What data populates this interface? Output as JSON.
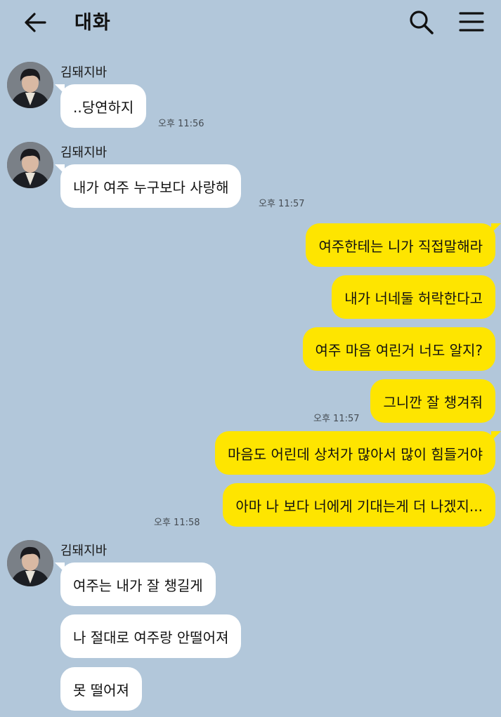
{
  "header": {
    "title": "대화"
  },
  "messages": [
    {
      "sender": "김돼지바",
      "text": "..당연하지",
      "time": "오후 11:56"
    },
    {
      "sender": "김돼지바",
      "text": "내가 여주 누구보다 사랑해",
      "time": "오후 11:57"
    },
    {
      "text": "여주한테는 니가 직접말해라"
    },
    {
      "text": "내가 너네둘 허락한다고"
    },
    {
      "text": "여주 마음 여린거 너도 알지?"
    },
    {
      "text": "그니깐 잘 챙겨줘",
      "time": "오후 11:57"
    },
    {
      "text": "마음도 어린데 상처가 많아서 많이 힘들거야"
    },
    {
      "text": "아마 나 보다 너에게 기대는게 더 나겠지...",
      "time": "오후 11:58"
    },
    {
      "sender": "김돼지바",
      "text": "여주는 내가 잘 챙길게"
    },
    {
      "text": "나 절대로 여주랑 안떨어져"
    },
    {
      "text": "못 떨어져"
    }
  ],
  "colors": {
    "background": "#b2c7da",
    "outgoing": "#fee500",
    "incoming": "#ffffff"
  },
  "icons": [
    "back-arrow-icon",
    "search-icon",
    "menu-icon"
  ]
}
